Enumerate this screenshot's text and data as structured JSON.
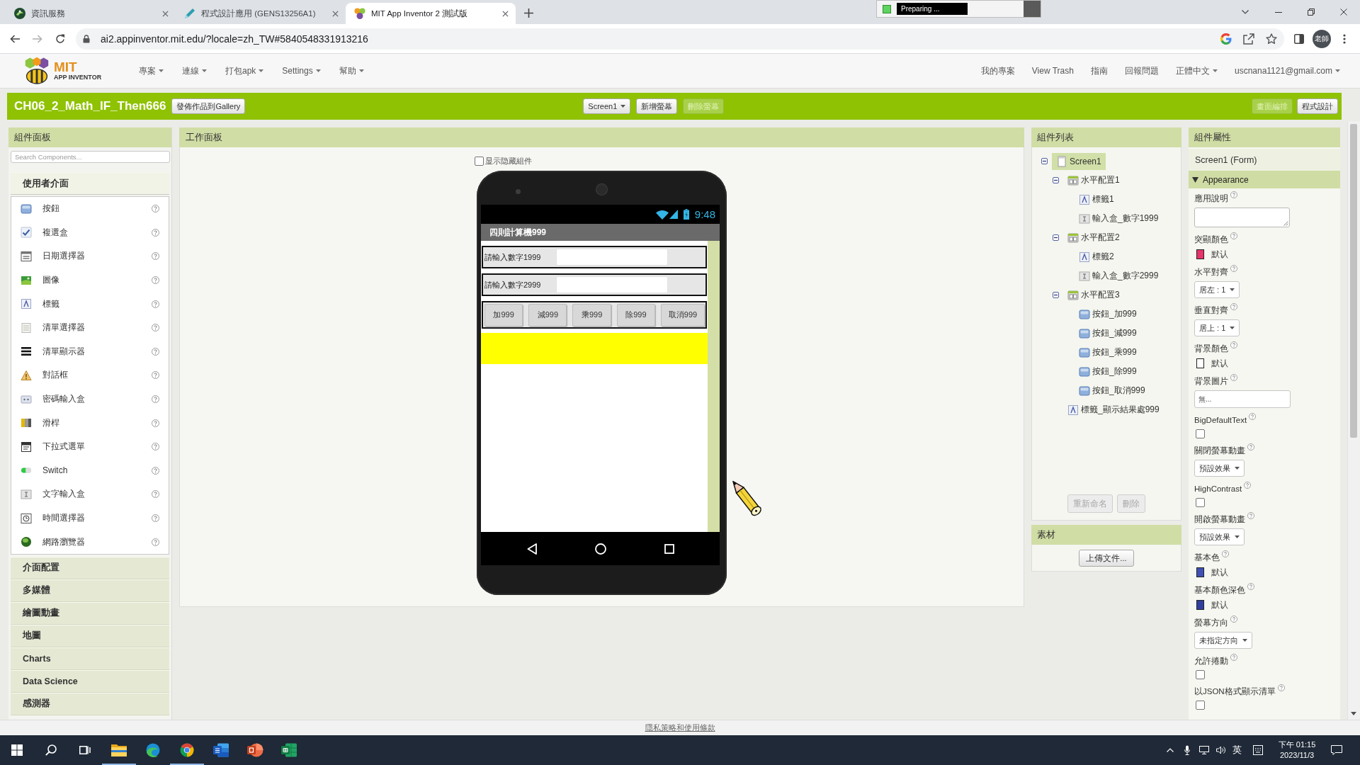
{
  "browser": {
    "tabs": [
      {
        "kind": "site",
        "title": "資訊服務",
        "selected": false
      },
      {
        "kind": "course",
        "title": "程式設計應用 (GENS13256A1)",
        "selected": false
      },
      {
        "kind": "appinventor",
        "title": "MIT App Inventor 2 測試版",
        "selected": true
      }
    ],
    "recorder_status": "Preparing ...",
    "url": "ai2.appinventor.mit.edu/?locale=zh_TW#5840548331913216",
    "profile": "老師"
  },
  "app_header": {
    "logo": {
      "title": "MIT",
      "subtitle": "APP INVENTOR"
    },
    "menus": [
      "專案",
      "連線",
      "打包apk",
      "Settings",
      "幫助"
    ],
    "links": [
      {
        "label": "我的專案",
        "dropdown": false
      },
      {
        "label": "View Trash",
        "dropdown": false
      },
      {
        "label": "指南",
        "dropdown": false
      },
      {
        "label": "回報問題",
        "dropdown": false
      },
      {
        "label": "正體中文",
        "dropdown": true
      },
      {
        "label": "uscnana1121@gmail.com",
        "dropdown": true
      }
    ]
  },
  "project_bar": {
    "project_name": "CH06_2_Math_IF_Then666",
    "gallery_button": "發佈作品到Gallery",
    "screen_select": "Screen1",
    "screen_buttons": [
      {
        "label": "新增螢幕",
        "disabled": false
      },
      {
        "label": "刪除螢幕",
        "disabled": true
      }
    ],
    "mode_buttons": [
      {
        "label": "畫面編排",
        "selected": true
      },
      {
        "label": "程式設計",
        "selected": false
      }
    ]
  },
  "palette": {
    "title": "組件面板",
    "search": {
      "placeholder": "Search Components..."
    },
    "categories": [
      {
        "label": "使用者介面",
        "expanded": true,
        "items": [
          {
            "kind": "button",
            "label": "按鈕"
          },
          {
            "kind": "checkbox",
            "label": "複選盒"
          },
          {
            "kind": "datepicker",
            "label": "日期選擇器"
          },
          {
            "kind": "image",
            "label": "圖像"
          },
          {
            "kind": "label",
            "label": "標籤"
          },
          {
            "kind": "listpicker",
            "label": "清單選擇器"
          },
          {
            "kind": "listview",
            "label": "清單顯示器"
          },
          {
            "kind": "notifier",
            "label": "對話框"
          },
          {
            "kind": "password",
            "label": "密碼輸入盒"
          },
          {
            "kind": "slider",
            "label": "滑桿"
          },
          {
            "kind": "spinner",
            "label": "下拉式選單"
          },
          {
            "kind": "switch",
            "label": "Switch"
          },
          {
            "kind": "textbox",
            "label": "文字輸入盒"
          },
          {
            "kind": "timepicker",
            "label": "時間選擇器"
          },
          {
            "kind": "webviewer",
            "label": "網路瀏覽器"
          }
        ]
      },
      {
        "label": "介面配置",
        "expanded": false
      },
      {
        "label": "多媒體",
        "expanded": false
      },
      {
        "label": "繪圖動畫",
        "expanded": false
      },
      {
        "label": "地圖",
        "expanded": false
      },
      {
        "label": "Charts",
        "expanded": false
      },
      {
        "label": "Data Science",
        "expanded": false
      },
      {
        "label": "感測器",
        "expanded": false
      }
    ]
  },
  "viewer": {
    "title": "工作面板",
    "show_hidden": {
      "label": "显示隐藏組件",
      "checked": false
    },
    "phone": {
      "time": "9:48",
      "title": "四則計算機999",
      "rows": [
        {
          "kind": "input",
          "label": "請輸入數字1999"
        },
        {
          "kind": "input",
          "label": "請輸入數字2999"
        },
        {
          "kind": "buttons",
          "buttons": [
            "加999",
            "減999",
            "乘999",
            "除999",
            "取消999"
          ]
        },
        {
          "kind": "result"
        }
      ]
    }
  },
  "components": {
    "title": "組件列表",
    "tree": [
      {
        "name": "Screen1",
        "kind": "screen",
        "selected": true,
        "expanded": true,
        "children": [
          {
            "name": "水平配置1",
            "kind": "arrangement",
            "selected": false,
            "expanded": true,
            "children": [
              {
                "name": "標籤1",
                "kind": "label",
                "selected": false
              },
              {
                "name": "輸入盒_數字1999",
                "kind": "textbox",
                "selected": false
              }
            ]
          },
          {
            "name": "水平配置2",
            "kind": "arrangement",
            "selected": false,
            "expanded": true,
            "children": [
              {
                "name": "標籤2",
                "kind": "label",
                "selected": false
              },
              {
                "name": "輸入盒_數字2999",
                "kind": "textbox",
                "selected": false
              }
            ]
          },
          {
            "name": "水平配置3",
            "kind": "arrangement",
            "selected": false,
            "expanded": true,
            "children": [
              {
                "name": "按鈕_加999",
                "kind": "button",
                "selected": false
              },
              {
                "name": "按鈕_減999",
                "kind": "button",
                "selected": false
              },
              {
                "name": "按鈕_乘999",
                "kind": "button",
                "selected": false
              },
              {
                "name": "按鈕_除999",
                "kind": "button",
                "selected": false
              },
              {
                "name": "按鈕_取消999",
                "kind": "button",
                "selected": false
              }
            ]
          },
          {
            "name": "標籤_顯示結果處999",
            "kind": "label",
            "selected": false
          }
        ]
      }
    ],
    "buttons": [
      {
        "label": "重新命名",
        "disabled": true
      },
      {
        "label": "刪除",
        "disabled": true
      }
    ]
  },
  "assets": {
    "title": "素材",
    "upload_button": "上傳文件..."
  },
  "properties": {
    "title": "組件屬性",
    "component": "Screen1 (Form)",
    "section": {
      "label": "Appearance",
      "expanded": true
    },
    "items": [
      {
        "kind": "textarea",
        "label": "應用說明"
      },
      {
        "kind": "color",
        "label": "突顯顏色",
        "color": "#e8336b",
        "value": "默认"
      },
      {
        "kind": "dropdown",
        "label": "水平對齊",
        "value": "居左 : 1"
      },
      {
        "kind": "dropdown",
        "label": "垂直對齊",
        "value": "居上 : 1"
      },
      {
        "kind": "color",
        "label": "背景顏色",
        "color": "#ffffff",
        "value": "默认"
      },
      {
        "kind": "text",
        "label": "背景圖片",
        "value": "無..."
      },
      {
        "kind": "checkbox",
        "label": "BigDefaultText",
        "checked": false
      },
      {
        "kind": "dropdown",
        "label": "關閉螢幕動畫",
        "value": "預設效果"
      },
      {
        "kind": "checkbox",
        "label": "HighContrast",
        "checked": false
      },
      {
        "kind": "dropdown",
        "label": "開啟螢幕動畫",
        "value": "預設效果"
      },
      {
        "kind": "color",
        "label": "基本色",
        "color": "#3f51b5",
        "value": "默认"
      },
      {
        "kind": "color",
        "label": "基本顏色深色",
        "color": "#303f9f",
        "value": "默认"
      },
      {
        "kind": "dropdown",
        "label": "螢幕方向",
        "value": "未指定方向"
      },
      {
        "kind": "checkbox",
        "label": "允許捲動",
        "checked": false
      },
      {
        "kind": "checkbox",
        "label": "以JSON格式顯示清單",
        "checked": false
      }
    ]
  },
  "footer": {
    "link": "隱私策略和使用條款"
  },
  "taskbar": {
    "apps": [
      {
        "kind": "explorer",
        "running": true
      },
      {
        "kind": "edge",
        "running": false
      },
      {
        "kind": "chrome",
        "running": true
      },
      {
        "kind": "word",
        "running": false
      },
      {
        "kind": "powerpoint",
        "running": false
      },
      {
        "kind": "excel",
        "running": false
      }
    ],
    "input_language": "英",
    "time": "下午 01:15",
    "date": "2023/11/3"
  }
}
